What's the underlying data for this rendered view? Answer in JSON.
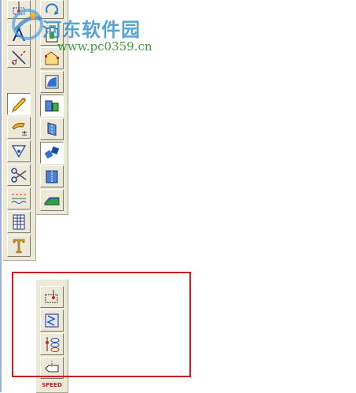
{
  "watermark": {
    "title": "河东软件园",
    "url": "www.pc0359.cn"
  },
  "toolbars": {
    "left_column": {
      "tools": [
        {
          "name": "mark-point-icon"
        },
        {
          "name": "compass-icon"
        },
        {
          "name": "cut-line-icon"
        },
        {
          "name": "pencil-icon",
          "pressed": true
        },
        {
          "name": "pen-plus-icon"
        },
        {
          "name": "triangle-measure-icon"
        },
        {
          "name": "scissors-icon"
        },
        {
          "name": "stitch-line-icon"
        },
        {
          "name": "grid-pattern-icon"
        },
        {
          "name": "text-tool-icon"
        }
      ]
    },
    "right_column": {
      "tools": [
        {
          "name": "rotate-piece-icon"
        },
        {
          "name": "garment-piece-icon"
        },
        {
          "name": "corner-shape-icon"
        },
        {
          "name": "square-frame-icon"
        },
        {
          "name": "blue-green-pieces-icon",
          "pressed": true
        },
        {
          "name": "mirror-piece-icon"
        },
        {
          "name": "blue-hand-icon"
        },
        {
          "name": "fold-piece-icon"
        },
        {
          "name": "green-slope-icon"
        }
      ]
    },
    "bottom_column": {
      "tools": [
        {
          "name": "dashed-box-point-icon"
        },
        {
          "name": "zigzag-frame-icon"
        },
        {
          "name": "pin-oval-icon"
        },
        {
          "name": "notch-arrow-icon"
        }
      ],
      "speed_label": "SPEED"
    }
  }
}
